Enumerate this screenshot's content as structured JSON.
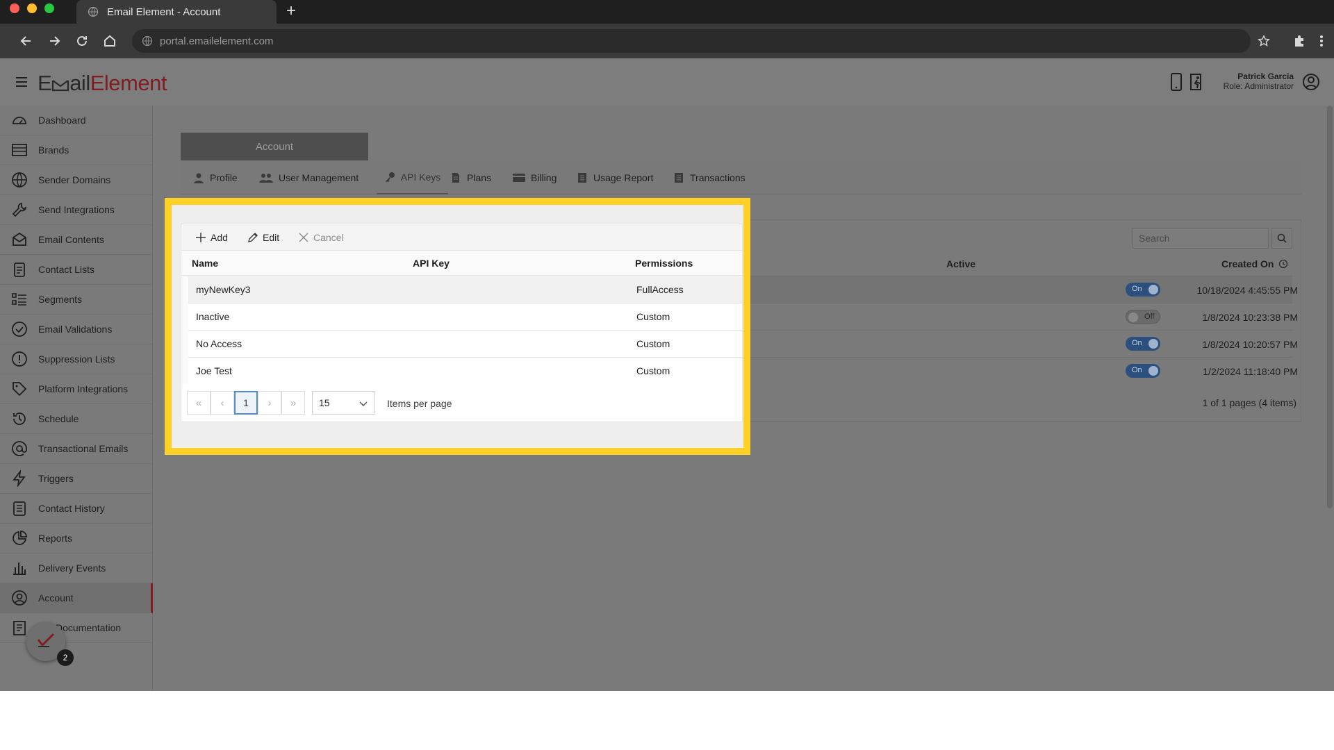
{
  "browser": {
    "tab_title": "Email Element - Account",
    "url": "portal.emailelement.com"
  },
  "header": {
    "logo_part1": "E",
    "logo_part2": "ail",
    "logo_part3": "Element",
    "user_name": "Patrick Garcia",
    "user_role": "Role: Administrator"
  },
  "sidebar": {
    "items": [
      {
        "label": "Dashboard",
        "icon": "dashboard-icon"
      },
      {
        "label": "Brands",
        "icon": "brands-icon"
      },
      {
        "label": "Sender Domains",
        "icon": "globe-icon"
      },
      {
        "label": "Send Integrations",
        "icon": "wrench-icon"
      },
      {
        "label": "Email Contents",
        "icon": "envelope-icon"
      },
      {
        "label": "Contact Lists",
        "icon": "clipboard-icon"
      },
      {
        "label": "Segments",
        "icon": "segments-icon"
      },
      {
        "label": "Email Validations",
        "icon": "check-circle-icon"
      },
      {
        "label": "Suppression Lists",
        "icon": "alert-circle-icon"
      },
      {
        "label": "Platform Integrations",
        "icon": "tag-icon"
      },
      {
        "label": "Schedule",
        "icon": "history-icon"
      },
      {
        "label": "Transactional Emails",
        "icon": "at-icon"
      },
      {
        "label": "Triggers",
        "icon": "bolt-icon"
      },
      {
        "label": "Contact History",
        "icon": "list-icon"
      },
      {
        "label": "Reports",
        "icon": "pie-chart-icon"
      },
      {
        "label": "Delivery Events",
        "icon": "bar-chart-icon"
      },
      {
        "label": "Account",
        "icon": "user-circle-icon"
      },
      {
        "label": "Documentation",
        "icon": "document-icon"
      }
    ],
    "badge_count": "2"
  },
  "account": {
    "section_tab": "Account",
    "tabs": [
      {
        "label": "Profile"
      },
      {
        "label": "User Management"
      },
      {
        "label": "API Keys"
      },
      {
        "label": "Plans"
      },
      {
        "label": "Billing"
      },
      {
        "label": "Usage Report"
      },
      {
        "label": "Transactions"
      }
    ]
  },
  "grid": {
    "toolbar": {
      "add": "Add",
      "edit": "Edit",
      "cancel": "Cancel"
    },
    "search_placeholder": "Search",
    "columns": {
      "name": "Name",
      "api_key": "API Key",
      "permissions": "Permissions",
      "active": "Active",
      "created_on": "Created On"
    },
    "rows": [
      {
        "name": "myNewKey3",
        "api_key": "",
        "permissions": "FullAccess",
        "active": "On",
        "created_on": "10/18/2024 4:45:55 PM"
      },
      {
        "name": "Inactive",
        "api_key": "",
        "permissions": "Custom",
        "active": "Off",
        "created_on": "1/8/2024 10:23:38 PM"
      },
      {
        "name": "No Access",
        "api_key": "",
        "permissions": "Custom",
        "active": "On",
        "created_on": "1/8/2024 10:20:57 PM"
      },
      {
        "name": "Joe Test",
        "api_key": "",
        "permissions": "Custom",
        "active": "On",
        "created_on": "1/2/2024 11:18:40 PM"
      }
    ],
    "pager": {
      "current_page": "1",
      "page_size": "15",
      "items_per_page_label": "Items per page",
      "info": "1 of 1 pages (4 items)",
      "first": "«",
      "prev": "‹",
      "next": "›",
      "last": "»"
    }
  },
  "colors": {
    "brand": "#7f1d22",
    "highlight": "#ffd026",
    "toggle_on": "#2d4f7d"
  }
}
